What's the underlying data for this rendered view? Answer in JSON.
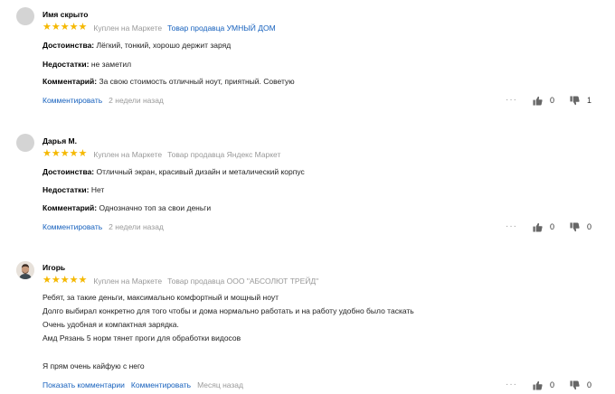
{
  "reviews": [
    {
      "author": "Имя скрыто",
      "bought": "Куплен на Маркете",
      "seller": "Товар продавца УМНЫЙ ДОМ",
      "seller_color": "#1560bd",
      "rating": 5,
      "pros_label": "Достоинства:",
      "pros": "Лёгкий, тонкий, хорошо держит заряд",
      "cons_label": "Недостатки:",
      "cons": "не заметил",
      "comment_label": "Комментарий:",
      "comment": "За свою стоимость отличный ноут, приятный. Советую",
      "comment_link": "Комментировать",
      "date": "2 недели назад",
      "more": "···",
      "likes": "0",
      "dislikes": "1"
    },
    {
      "author": "Дарья М.",
      "bought": "Куплен на Маркете",
      "seller": "Товар продавца Яндекс Маркет",
      "seller_color": "#999999",
      "rating": 5,
      "pros_label": "Достоинства:",
      "pros": "Отличный экран, красивый дизайн и металический корпус",
      "cons_label": "Недостатки:",
      "cons": "Нет",
      "comment_label": "Комментарий:",
      "comment": "Однозначно топ за свои деньги",
      "comment_link": "Комментировать",
      "date": "2 недели назад",
      "more": "···",
      "likes": "0",
      "dislikes": "0"
    },
    {
      "author": "Игорь",
      "bought": "Куплен на Маркете",
      "seller": "Товар продавца ООО \"АБСОЛЮТ ТРЕЙД\"",
      "seller_color": "#999999",
      "rating": 5,
      "text_lines": [
        "Ребят, за такие деньги, максимально комфортный и мощный ноут",
        "Долго выбирал конкретно для того чтобы и дома нормально работать и на работу удобно было таскать",
        "Очень удобная и компактная зарядка.",
        "Амд Рязань 5 норм тянет проги для обработки видосов",
        "",
        "Я прям очень кайфую с него"
      ],
      "show_comments_link": "Показать комментарии",
      "comment_link": "Комментировать",
      "date": "Месяц назад",
      "more": "···",
      "likes": "0",
      "dislikes": "0"
    }
  ],
  "icons": {
    "star": "star-icon",
    "like": "thumb-up-icon",
    "dislike": "thumb-down-icon",
    "more": "more-dots-icon"
  },
  "colors": {
    "star": "#f5b800",
    "link": "#1560bd",
    "muted": "#999999"
  }
}
